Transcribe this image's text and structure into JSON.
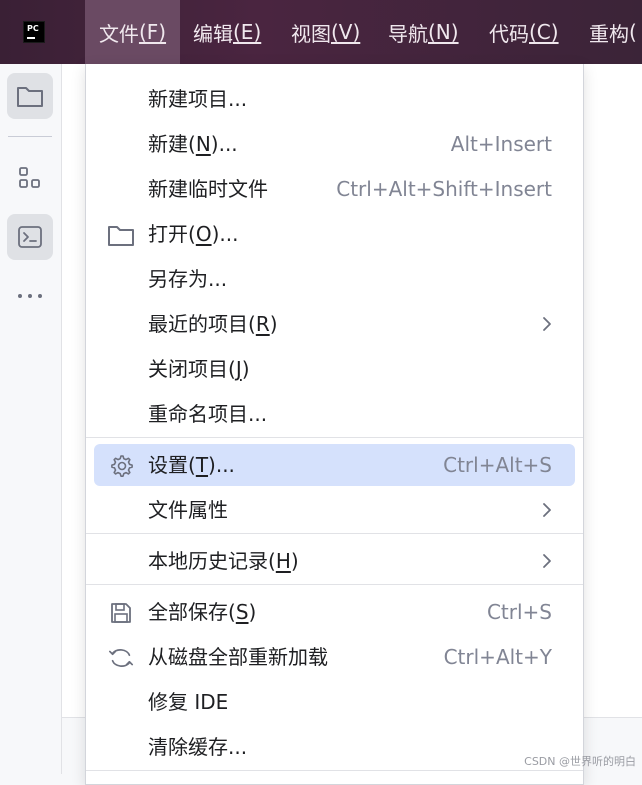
{
  "app": {
    "logo_text": "PC"
  },
  "menubar": [
    {
      "label": "文件",
      "mnemonic": "(F)"
    },
    {
      "label": "编辑",
      "mnemonic": "(E)"
    },
    {
      "label": "视图",
      "mnemonic": "(V)"
    },
    {
      "label": "导航",
      "mnemonic": "(N)"
    },
    {
      "label": "代码",
      "mnemonic": "(C)"
    },
    {
      "label": "重构",
      "mnemonic": "("
    }
  ],
  "toolstrip": [
    {
      "icon": "folder-icon",
      "selected": true
    },
    {
      "icon": "structure-icon",
      "selected": false
    },
    {
      "icon": "terminal-icon",
      "selected": true
    },
    {
      "icon": "more-icon",
      "selected": false
    }
  ],
  "file_menu": {
    "new_project": "新建项目...",
    "new": {
      "pre": "新建(",
      "key": "N",
      "post": ")...",
      "shortcut": "Alt+Insert"
    },
    "new_scratch": {
      "label": "新建临时文件",
      "shortcut": "Ctrl+Alt+Shift+Insert"
    },
    "open": {
      "pre": "打开(",
      "key": "O",
      "post": ")...",
      "icon": "folder-icon"
    },
    "save_as": "另存为...",
    "recent": {
      "pre": "最近的项目(",
      "key": "R",
      "post": ")"
    },
    "close_project": {
      "pre": "关闭项目(",
      "key": "J",
      "post": ")"
    },
    "rename_project": "重命名项目...",
    "settings": {
      "pre": "设置(",
      "key": "T",
      "post": ")...",
      "shortcut": "Ctrl+Alt+S",
      "icon": "gear-icon"
    },
    "file_properties": "文件属性",
    "local_history": {
      "pre": "本地历史记录(",
      "key": "H",
      "post": ")"
    },
    "save_all": {
      "pre": "全部保存(",
      "key": "S",
      "post": ")",
      "shortcut": "Ctrl+S",
      "icon": "save-icon"
    },
    "reload_from_disk": {
      "label": "从磁盘全部重新加载",
      "shortcut": "Ctrl+Alt+Y",
      "icon": "reload-icon"
    },
    "repair_ide": "修复 IDE",
    "invalidate_caches": "清除缓存..."
  },
  "watermark": "CSDN @世界听的明白"
}
